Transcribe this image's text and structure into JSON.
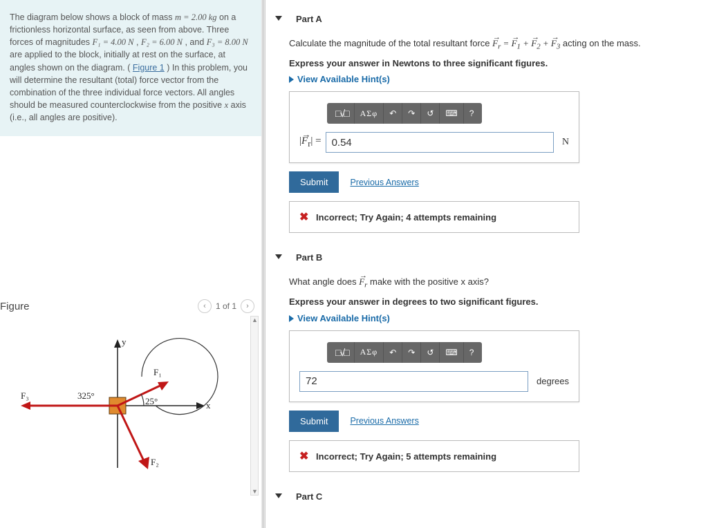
{
  "intro": {
    "text_before": "The diagram below shows a block of mass ",
    "m_expr": "m = 2.00 kg",
    "text_mid1": " on a frictionless horizontal surface, as seen from above. Three forces of magnitudes ",
    "f1_expr": "F₁ = 4.00 N",
    "sep1": ", ",
    "f2_expr": "F₂ = 6.00 N",
    "sep2": ", and ",
    "f3_expr": "F₃ = 8.00 N",
    "text_mid2": " are applied to the block, initially at rest on the surface, at angles shown on the diagram. (",
    "figlink": "Figure 1",
    "text_mid3": ") In this problem, you will determine the resultant (total) force vector from the combination of the three individual force vectors. All angles should be measured counterclockwise from the positive ",
    "xaxis": "x",
    "text_end": " axis (i.e., all angles are positive)."
  },
  "figure": {
    "title": "Figure",
    "page": "1 of 1",
    "labels": {
      "y": "y",
      "x": "x",
      "F1": "F₁",
      "F2": "F₂",
      "F3": "F₃",
      "a25": "25°",
      "a325": "325°"
    }
  },
  "partA": {
    "title": "Part A",
    "prompt_pre": "Calculate the magnitude of the total resultant force ",
    "eq": "Fᵣ = F₁ + F₂ + F₃",
    "prompt_post": " acting on the mass.",
    "instruction": "Express your answer in Newtons to three significant figures.",
    "hints": "View Available Hint(s)",
    "toolbar": {
      "tmpl": "□√□",
      "greek": "ΑΣφ",
      "undo": "↶",
      "redo": "↷",
      "reset": "↺",
      "kb": "⌨",
      "help": "?"
    },
    "answer_label": "|Fᵣ| =",
    "answer_value": "0.54",
    "unit": "N",
    "submit": "Submit",
    "prev": "Previous Answers",
    "feedback": "Incorrect; Try Again; 4 attempts remaining"
  },
  "partB": {
    "title": "Part B",
    "prompt_pre": "What angle does ",
    "fr": "Fᵣ",
    "prompt_post": " make with the positive x axis?",
    "instruction": "Express your answer in degrees to two significant figures.",
    "hints": "View Available Hint(s)",
    "toolbar": {
      "tmpl": "□√□",
      "greek": "ΑΣφ",
      "undo": "↶",
      "redo": "↷",
      "reset": "↺",
      "kb": "⌨",
      "help": "?"
    },
    "answer_value": "72",
    "unit": "degrees",
    "submit": "Submit",
    "prev": "Previous Answers",
    "feedback": "Incorrect; Try Again; 5 attempts remaining"
  },
  "partC": {
    "title": "Part C"
  }
}
